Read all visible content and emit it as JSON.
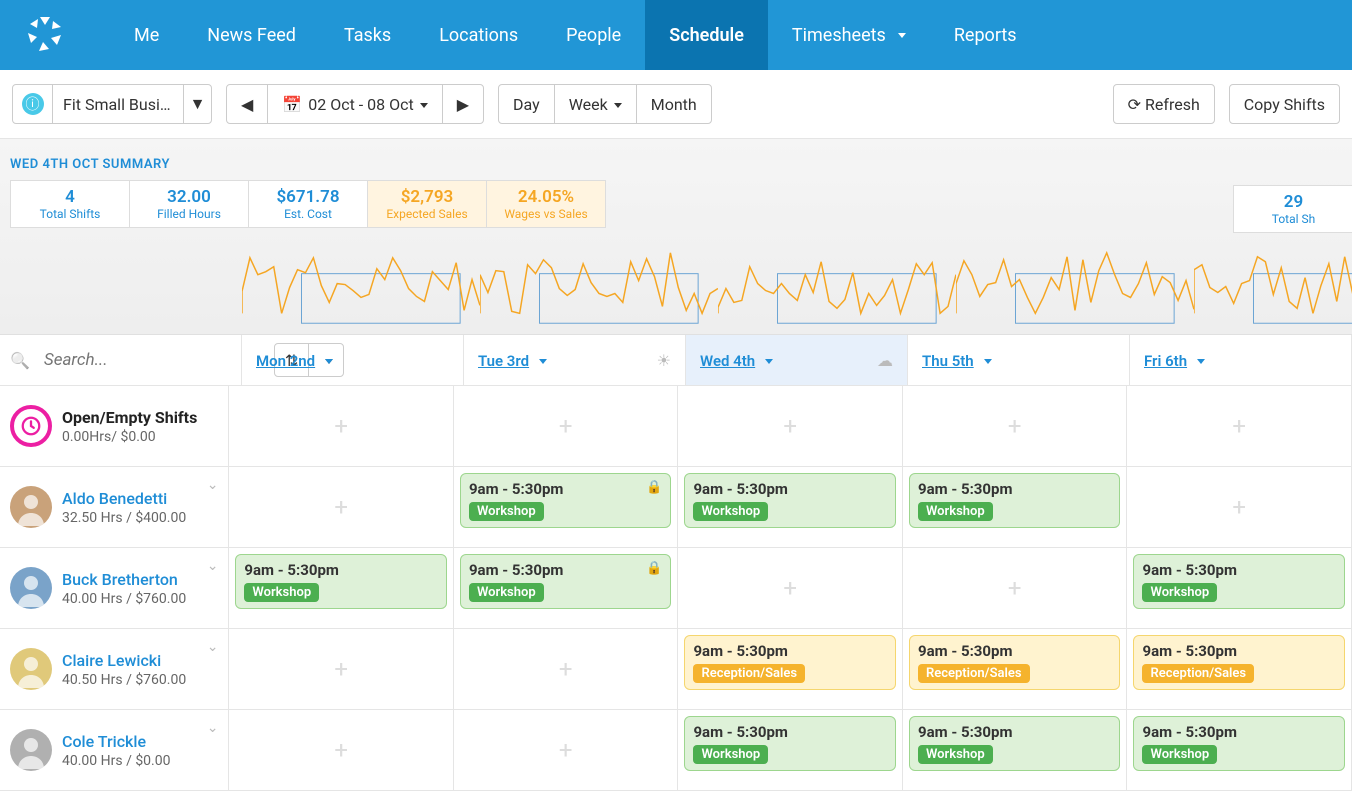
{
  "nav": {
    "items": [
      "Me",
      "News Feed",
      "Tasks",
      "Locations",
      "People",
      "Schedule",
      "Timesheets",
      "Reports"
    ],
    "active": "Schedule",
    "dropdown": [
      "Timesheets"
    ]
  },
  "toolbar": {
    "location": "Fit Small Busin…",
    "date_range": "02 Oct - 08 Oct",
    "view_day": "Day",
    "view_week": "Week",
    "view_month": "Month",
    "refresh": "Refresh",
    "copy_shifts": "Copy Shifts"
  },
  "summary": {
    "title": "WED 4TH OCT SUMMARY",
    "boxes": [
      {
        "value": "4",
        "label": "Total Shifts",
        "style": "blue"
      },
      {
        "value": "32.00",
        "label": "Filled Hours",
        "style": "blue"
      },
      {
        "value": "$671.78",
        "label": "Est. Cost",
        "style": "blue"
      },
      {
        "value": "$2,793",
        "label": "Expected Sales",
        "style": "yellow"
      },
      {
        "value": "24.05%",
        "label": "Wages vs Sales",
        "style": "yellow"
      }
    ],
    "right_box": {
      "value": "29",
      "label": "Total Sh"
    }
  },
  "schedule": {
    "search_placeholder": "Search...",
    "days": [
      {
        "label": "Mon 2nd",
        "today": false,
        "weather": null
      },
      {
        "label": "Tue 3rd",
        "today": false,
        "weather": "sun"
      },
      {
        "label": "Wed 4th",
        "today": true,
        "weather": "cloud"
      },
      {
        "label": "Thu 5th",
        "today": false,
        "weather": null
      },
      {
        "label": "Fri 6th",
        "today": false,
        "weather": null
      }
    ],
    "rows": [
      {
        "name": "Open/Empty Shifts",
        "meta": "0.00Hrs/ $0.00",
        "type": "open",
        "shifts": [
          null,
          null,
          null,
          null,
          null
        ]
      },
      {
        "name": "Aldo Benedetti",
        "meta": "32.50 Hrs / $400.00",
        "type": "emp",
        "avatar_color": "#c9a27a",
        "shifts": [
          null,
          {
            "time": "9am - 5:30pm",
            "area": "Workshop",
            "kind": "green",
            "locked": true
          },
          {
            "time": "9am - 5:30pm",
            "area": "Workshop",
            "kind": "green"
          },
          {
            "time": "9am - 5:30pm",
            "area": "Workshop",
            "kind": "green"
          },
          null
        ]
      },
      {
        "name": "Buck Bretherton",
        "meta": "40.00 Hrs / $760.00",
        "type": "emp",
        "avatar_color": "#7aa3c9",
        "shifts": [
          {
            "time": "9am - 5:30pm",
            "area": "Workshop",
            "kind": "green"
          },
          {
            "time": "9am - 5:30pm",
            "area": "Workshop",
            "kind": "green",
            "locked": true
          },
          null,
          null,
          {
            "time": "9am - 5:30pm",
            "area": "Workshop",
            "kind": "green"
          }
        ]
      },
      {
        "name": "Claire Lewicki",
        "meta": "40.50 Hrs / $760.00",
        "type": "emp",
        "avatar_color": "#e0c97a",
        "shifts": [
          null,
          null,
          {
            "time": "9am - 5:30pm",
            "area": "Reception/Sales",
            "kind": "yellow"
          },
          {
            "time": "9am - 5:30pm",
            "area": "Reception/Sales",
            "kind": "yellow"
          },
          {
            "time": "9am - 5:30pm",
            "area": "Reception/Sales",
            "kind": "yellow"
          }
        ]
      },
      {
        "name": "Cole Trickle",
        "meta": "40.00 Hrs / $0.00",
        "type": "emp",
        "avatar_color": "#b0b0b0",
        "shifts": [
          null,
          null,
          {
            "time": "9am - 5:30pm",
            "area": "Workshop",
            "kind": "green"
          },
          {
            "time": "9am - 5:30pm",
            "area": "Workshop",
            "kind": "green"
          },
          {
            "time": "9am - 5:30pm",
            "area": "Workshop",
            "kind": "green"
          }
        ]
      }
    ]
  }
}
